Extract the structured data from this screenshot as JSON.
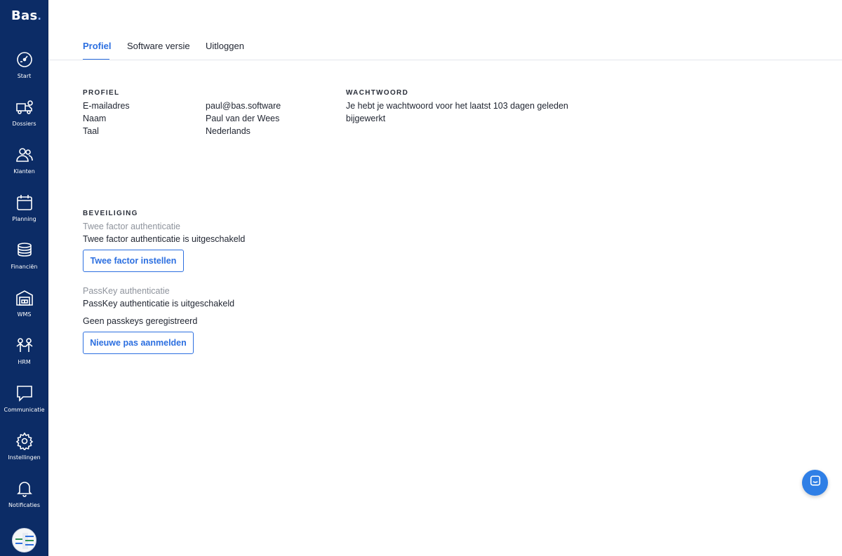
{
  "app": {
    "logo": "Bas",
    "logo_dot": "."
  },
  "sidebar": {
    "items": [
      {
        "label": "Start",
        "icon": "speedometer-icon"
      },
      {
        "label": "Dossiers",
        "icon": "truck-icon"
      },
      {
        "label": "Klanten",
        "icon": "users-icon"
      },
      {
        "label": "Planning",
        "icon": "calendar-icon"
      },
      {
        "label": "Financiën",
        "icon": "coins-icon"
      },
      {
        "label": "WMS",
        "icon": "warehouse-icon"
      },
      {
        "label": "HRM",
        "icon": "team-icon"
      },
      {
        "label": "Communicatie",
        "icon": "chat-icon"
      },
      {
        "label": "Instellingen",
        "icon": "gear-icon"
      },
      {
        "label": "Notificaties",
        "icon": "bell-icon"
      }
    ]
  },
  "tabs": [
    {
      "label": "Profiel",
      "active": true
    },
    {
      "label": "Software versie",
      "active": false
    },
    {
      "label": "Uitloggen",
      "active": false
    }
  ],
  "profile": {
    "title": "PROFIEL",
    "rows": [
      {
        "label": "E-mailadres",
        "value": "paul@bas.software"
      },
      {
        "label": "Naam",
        "value": "Paul van der Wees"
      },
      {
        "label": "Taal",
        "value": "Nederlands"
      }
    ]
  },
  "password": {
    "title": "WACHTWOORD",
    "line1": "Je hebt je wachtwoord voor het laatst 103 dagen geleden",
    "line2": "bijgewerkt"
  },
  "security": {
    "title": "BEVEILIGING",
    "twofactor_label": "Twee factor authenticatie",
    "twofactor_status": "Twee factor authenticatie is uitgeschakeld",
    "twofactor_button": "Twee factor instellen",
    "passkey_label": "PassKey authenticatie",
    "passkey_status": "PassKey authenticatie is uitgeschakeld",
    "passkey_none": "Geen passkeys geregistreerd",
    "passkey_button": "Nieuwe pas aanmelden"
  },
  "colors": {
    "sidebar": "#0c2c66",
    "accent": "#2c6fe0",
    "fab": "#2f7fe6"
  }
}
